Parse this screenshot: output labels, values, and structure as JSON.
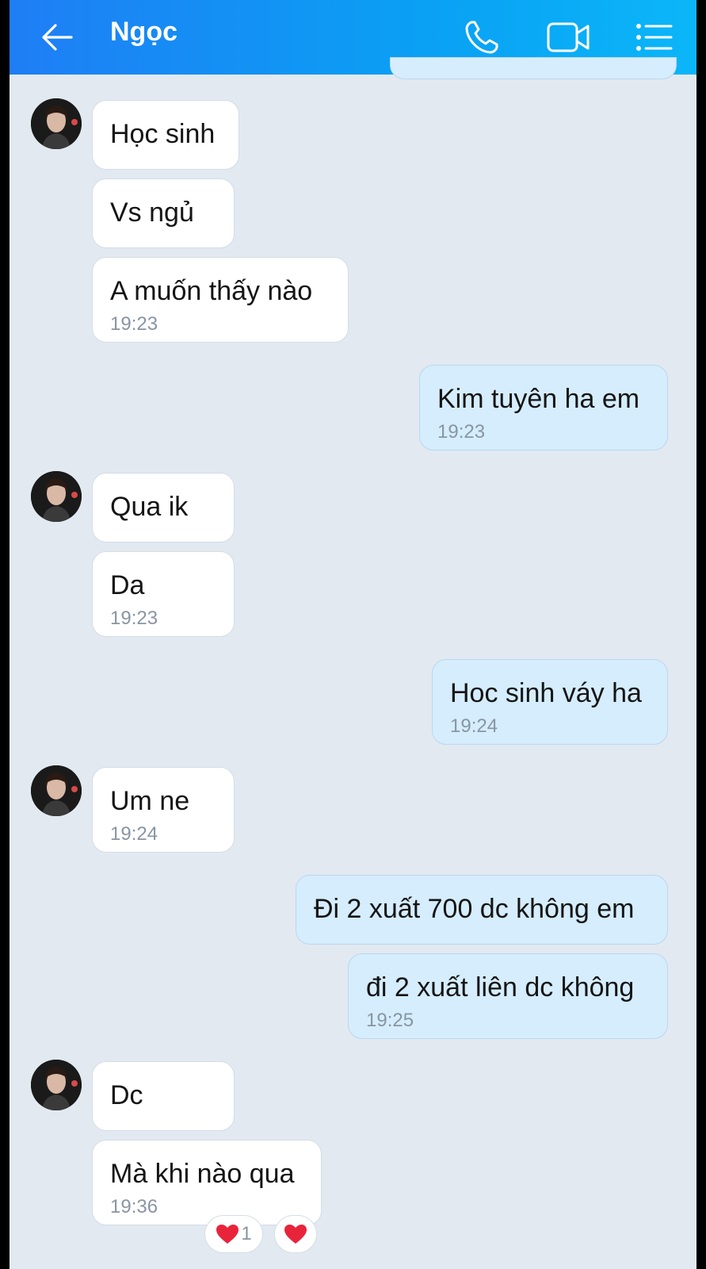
{
  "header": {
    "title": "Ngọc",
    "icons": [
      "back-arrow-icon",
      "phone-icon",
      "video-call-icon",
      "list-menu-icon"
    ]
  },
  "colors": {
    "header_start": "#1f7ef5",
    "header_end": "#0bb6f8",
    "background": "#e2e9f1",
    "incoming_bubble": "#ffffff",
    "outgoing_bubble": "#d5edfd",
    "time_text": "#8895a3",
    "heart": "#e8243b"
  },
  "messages": [
    {
      "side": "in",
      "text": "Học sinh",
      "time": ""
    },
    {
      "side": "in",
      "text": "Vs ngủ",
      "time": ""
    },
    {
      "side": "in",
      "text": "A muốn thấy nào",
      "time": "19:23"
    },
    {
      "side": "out",
      "text": "Kim tuyên ha em",
      "time": "19:23"
    },
    {
      "side": "in",
      "text": "Qua ik",
      "time": ""
    },
    {
      "side": "in",
      "text": "Da",
      "time": "19:23"
    },
    {
      "side": "out",
      "text": "Hoc sinh váy ha",
      "time": "19:24"
    },
    {
      "side": "in",
      "text": "Um ne",
      "time": "19:24"
    },
    {
      "side": "out",
      "text": "Đi 2 xuất 700 dc không em",
      "time": ""
    },
    {
      "side": "out",
      "text": "đi 2 xuất liên dc không",
      "time": "19:25"
    },
    {
      "side": "in",
      "text": "Dc",
      "time": ""
    },
    {
      "side": "in",
      "text": "Mà khi nào qua",
      "time": "19:36"
    }
  ],
  "reaction": {
    "count": "1",
    "icon": "heart-icon"
  }
}
